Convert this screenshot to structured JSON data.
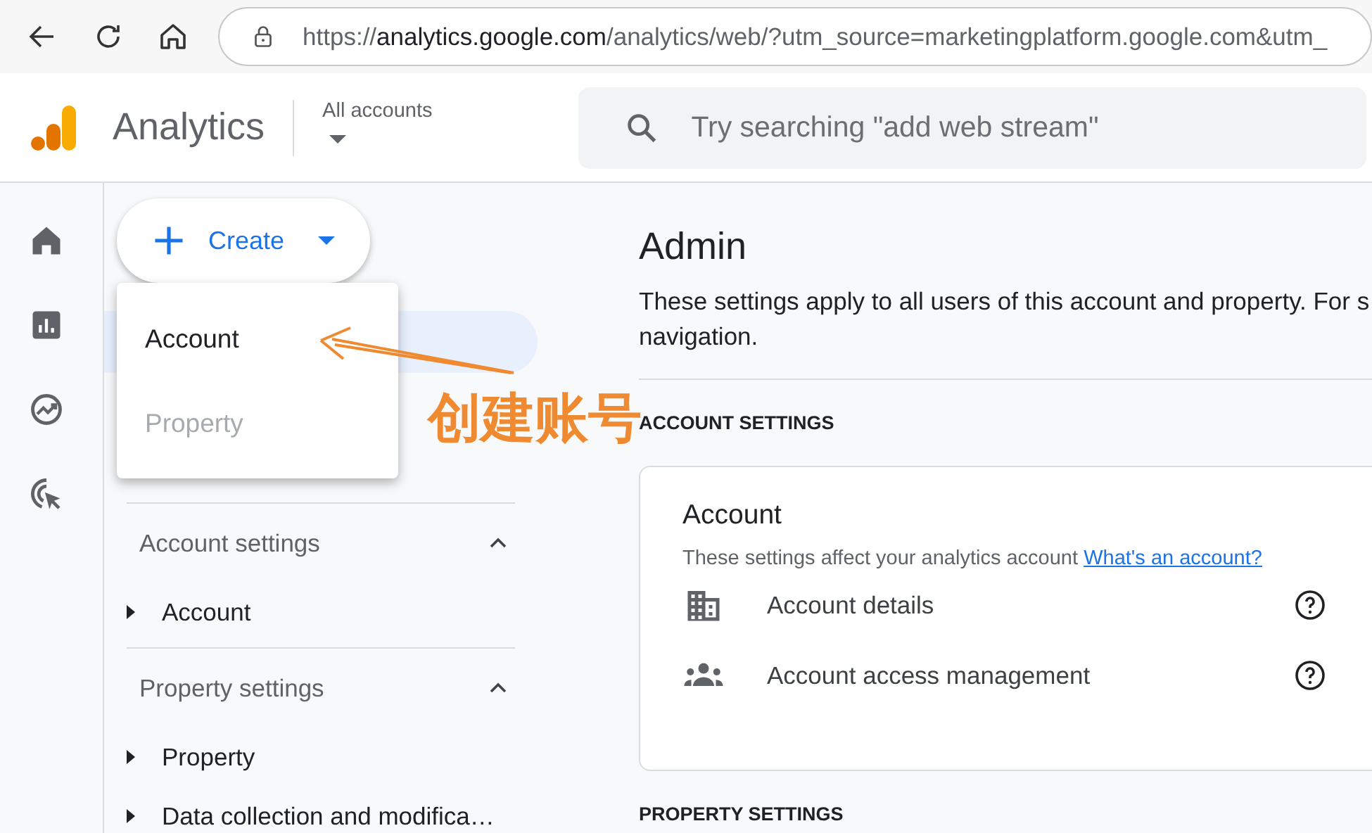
{
  "browser": {
    "url": "https://**analytics.google.com**/analytics/web/?utm_source=marketingplatform.google.com&utm_"
  },
  "header": {
    "app_name": "Analytics",
    "account_picker": "All accounts",
    "search": {
      "placeholder": "Try searching \"add web stream\""
    }
  },
  "nav": {
    "create_button": {
      "label": "Create"
    },
    "create_menu": [
      {
        "label": "Account",
        "disabled": false
      },
      {
        "label": "Property",
        "disabled": true
      }
    ],
    "sections": [
      {
        "title": "Account settings",
        "expanded": true,
        "items": [
          {
            "label": "Account",
            "expanded": false
          }
        ]
      },
      {
        "title": "Property settings",
        "expanded": true,
        "items": [
          {
            "label": "Property",
            "expanded": false
          },
          {
            "label": "Data collection and modifica…",
            "expanded": false
          }
        ]
      }
    ]
  },
  "annotation": {
    "text": "创建账号"
  },
  "main": {
    "title": "Admin",
    "description_lines": [
      "These settings apply to all users of this account and property. For s",
      "navigation."
    ],
    "groups": [
      {
        "heading": "ACCOUNT SETTINGS",
        "card": {
          "title": "Account",
          "description": "These settings affect your analytics account",
          "link": "What's an account?",
          "rows": [
            {
              "kind": "building",
              "label": "Account details"
            },
            {
              "kind": "people",
              "label": "Account access management"
            }
          ]
        }
      },
      {
        "heading": "PROPERTY SETTINGS"
      }
    ]
  }
}
